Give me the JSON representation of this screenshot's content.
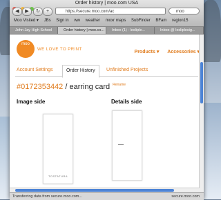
{
  "window": {
    "title": "Order history | moo.com USA"
  },
  "url": {
    "value": "https://secure.moo.com/ac"
  },
  "search": {
    "value": "moo"
  },
  "bookmarks": [
    "Moo Visited ▾",
    "JBs",
    "Sign in",
    "ww",
    "weather",
    "moxr maps",
    "SubFinder",
    "BFam",
    "region15"
  ],
  "tabs": [
    {
      "label": "John Jay High School"
    },
    {
      "label": "Order history | moo.co..."
    },
    {
      "label": "Inbox (1) - lesliple..."
    },
    {
      "label": "Inbox @ lesliplesig..."
    }
  ],
  "site": {
    "logo": "moo",
    "tagline": "WE LOVE TO PRINT",
    "nav": {
      "products": "Products ▾",
      "accessories": "Accessories ▾"
    }
  },
  "subnav": {
    "account_settings": "Account Settings",
    "order_history": "Order History",
    "unfinished": "Unfinished Projects"
  },
  "order": {
    "number": "#0172353442",
    "separator": " / ",
    "name": "earring card",
    "rename": "Rename"
  },
  "sections": {
    "image_side": "Image side",
    "details_side": "Details side"
  },
  "card": {
    "text": "TOSTATURA"
  },
  "status": {
    "left": "Transferring data from secure.moo.com...",
    "right": "secure.moo.com"
  },
  "colors": {
    "brand": "#f08a24",
    "accent": "#4d84d6"
  }
}
